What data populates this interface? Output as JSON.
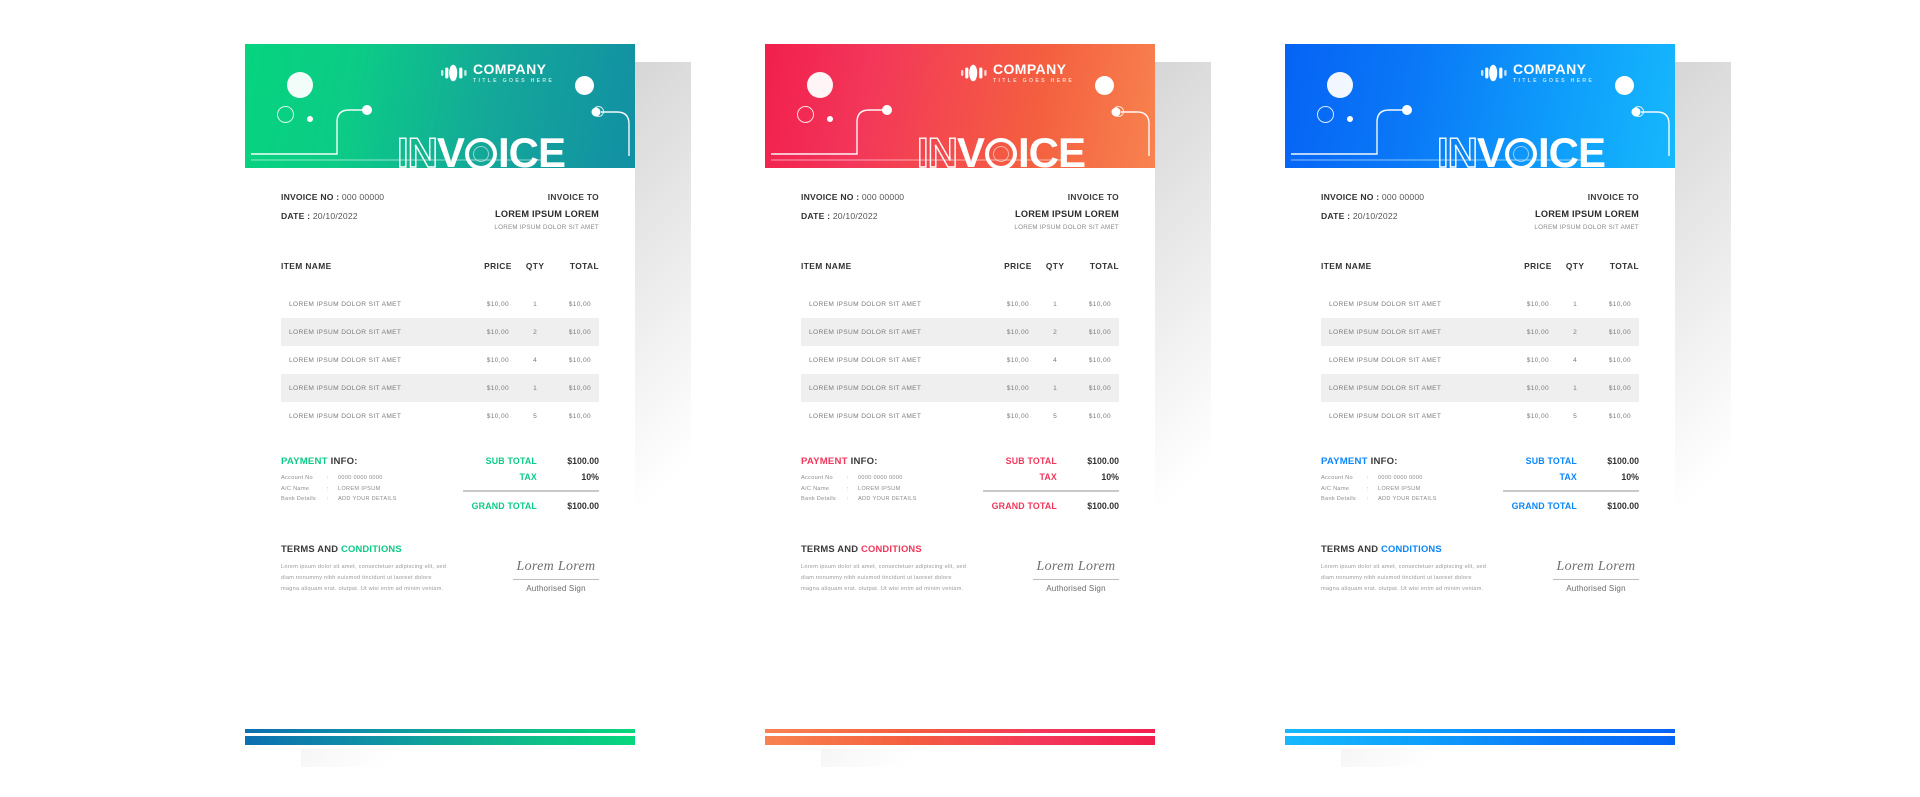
{
  "theme": {
    "variants": [
      {
        "id": "green",
        "accent": "#0ccb86",
        "header_gradient_from": "#06d47f",
        "header_gradient_to": "#128fa4"
      },
      {
        "id": "red",
        "accent": "#f1365b",
        "header_gradient_from": "#f11f4d",
        "header_gradient_to": "#f88350"
      },
      {
        "id": "blue",
        "accent": "#0a86f9",
        "header_gradient_from": "#0663f5",
        "header_gradient_to": "#16b8fd"
      }
    ]
  },
  "header": {
    "logo_name": "COMPANY",
    "logo_subtitle": "TITLE GOES HERE",
    "wordmark_outline": "IN",
    "wordmark_v": "V",
    "wordmark_solid": "ICE"
  },
  "meta": {
    "invoice_no_label": "INVOICE NO :",
    "invoice_no_value": "000 00000",
    "date_label": "DATE :",
    "date_value": "20/10/2022",
    "invoice_to_label": "INVOICE TO",
    "client_name": "LOREM IPSUM LOREM",
    "client_address": "LOREM IPSUM DOLOR SIT AMET"
  },
  "table": {
    "columns": [
      "ITEM NAME",
      "PRICE",
      "QTY",
      "TOTAL"
    ],
    "rows": [
      {
        "item": "LOREM IPSUM DOLOR SIT AMET",
        "price": "$10,00",
        "qty": "1",
        "total": "$10,00"
      },
      {
        "item": "LOREM IPSUM DOLOR SIT AMET",
        "price": "$10,00",
        "qty": "2",
        "total": "$10,00"
      },
      {
        "item": "LOREM IPSUM DOLOR SIT AMET",
        "price": "$10,00",
        "qty": "4",
        "total": "$10,00"
      },
      {
        "item": "LOREM IPSUM DOLOR SIT AMET",
        "price": "$10,00",
        "qty": "1",
        "total": "$10,00"
      },
      {
        "item": "LOREM IPSUM DOLOR SIT AMET",
        "price": "$10,00",
        "qty": "5",
        "total": "$10,00"
      }
    ]
  },
  "payment": {
    "title_accent": "PAYMENT",
    "title_rest": "INFO:",
    "rows": [
      {
        "key": "Account No",
        "sep": ":",
        "value": "0000 0000 0000"
      },
      {
        "key": "A/C Name",
        "sep": ":",
        "value": "LOREM IPSUM"
      },
      {
        "key": "Bank Details",
        "sep": ":",
        "value": "ADD YOUR DETAILS"
      }
    ]
  },
  "totals": {
    "sub_total_label": "SUB TOTAL",
    "sub_total_value": "$100.00",
    "tax_label": "TAX",
    "tax_value": "10%",
    "grand_total_label": "GRAND TOTAL",
    "grand_total_value": "$100.00"
  },
  "terms": {
    "title_plain": "TERMS AND",
    "title_accent": "CONDITIONS",
    "body": "Lorem ipsum dolor sit amet, consectetuer adipiscing elit, sed diam nonummy nibh euismod tincidunt ut laoreet dolore magna aliquam erat. olutpat. Ut wisi enim ad minim veniam."
  },
  "signature": {
    "script": "Lorem Lorem",
    "label": "Authorised Sign"
  }
}
